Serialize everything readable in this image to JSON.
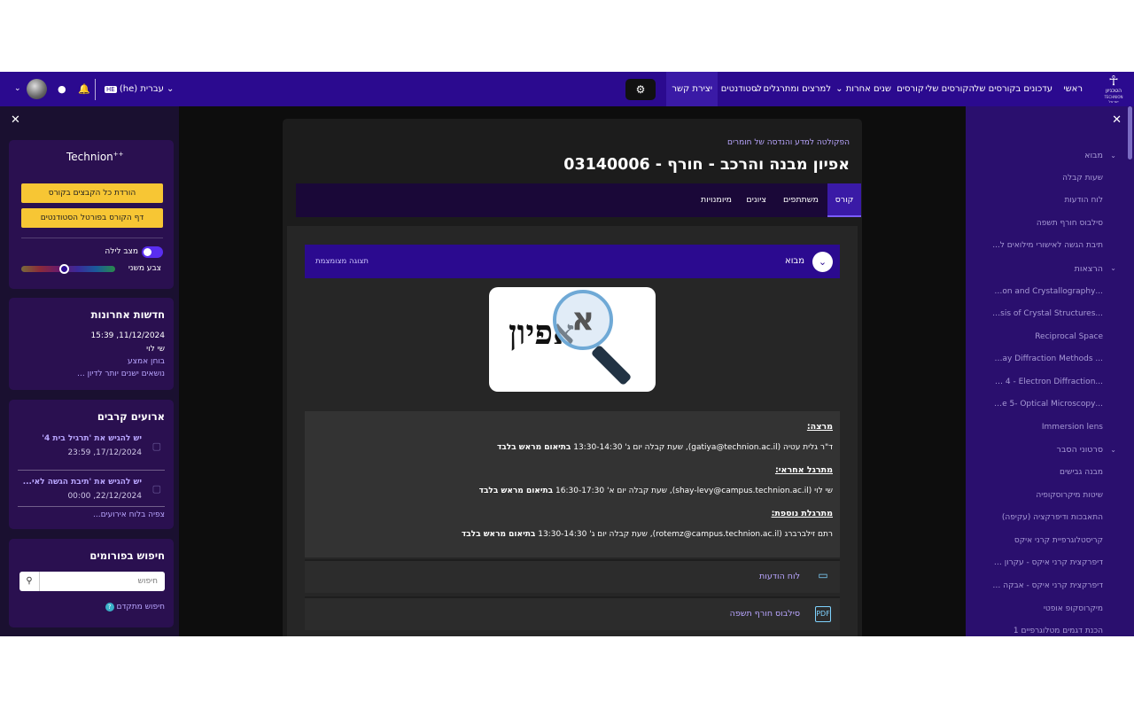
{
  "navbar": {
    "logo": {
      "line1": "הטכניון",
      "line2": "TECHNION",
      "line3": "ישראל"
    },
    "items": [
      "ראשי",
      "עדכונים בקורסים שלי",
      "הקורסים שלי",
      "קורסים",
      "שנים אחרות",
      "למרצים ומתרגלים",
      "לסטודנטים",
      "יצירת קשר"
    ],
    "language": "עברית (he)",
    "lang_code": "HE"
  },
  "left_drawer": {
    "brand": "Technion",
    "brand_sup": "++",
    "download_all": "הורדת כל הקבצים בקורס",
    "student_portal": "דף הקורס בפורטל הסטודנטים",
    "night_mode": "מצב לילה",
    "secondary_color": "צבע משני",
    "news": {
      "title": "חדשות אחרונות",
      "date": "11/12/2024, 15:39",
      "author": "שי לוי",
      "subject": "בוחן אמצע",
      "older": "נושאים ישנים יותר לדיון ..."
    },
    "events": {
      "title": "ארועים קרבים",
      "items": [
        {
          "title": "יש להגיש את 'תרגיל בית 4'",
          "date": "17/12/2024, 23:59"
        },
        {
          "title": "יש להגיש את 'תיבת הגשה לאי...",
          "date": "22/12/2024, 00:00"
        }
      ],
      "calendar_link": "צפיה בלוח אירועים..."
    },
    "forum_search": {
      "title": "חיפוש בפורומים",
      "placeholder": "חיפוש",
      "advanced": "חיפוש מתקדם"
    }
  },
  "course": {
    "breadcrumb": "הפקולטה למדע והנדסה של חומרים",
    "title": "אפיון מבנה והרכב - חורף - 03140006",
    "tabs": [
      "קורס",
      "משתתפים",
      "ציונים",
      "מיומנויות"
    ],
    "section": {
      "title": "מבוא",
      "collapsed_view": "תצוגה מצומצמת"
    },
    "image_text": "אפיון",
    "lecturer_label": "מרצה:",
    "lecturer_line_a": "ד\"ר גלית עטיה (gatiya@technion.ac.il), שעת קבלה יום ג' 13:30-14:30 ",
    "lecturer_line_b": "בתיאום מראש בלבד",
    "ta_label": "מתרגל אחראי:",
    "ta_line_a": "שי לוי (shay-levy@campus.technion.ac.il), שעת קבלה יום א' 16:30-17:30 ",
    "ta_line_b": "בתיאום מראש בלבד",
    "ta2_label": "מתרגלת נוספת:",
    "ta2_line_a": "רתם זילברברג (rotemz@campus.technion.ac.il), שעת קבלה יום ג' 13:30-14:30 ",
    "ta2_line_b": "בתיאום מראש בלבד",
    "activities": [
      "לוח הודעות",
      "סילבוס חורף תשפה"
    ]
  },
  "right_drawer": {
    "sections": [
      {
        "title": "מבוא",
        "items": [
          "שעות קבלה",
          "לוח הודעות",
          "סילבוס חורף תשפה",
          "תיבת הגשה לאישורי מילואים ל..."
        ]
      },
      {
        "title": "הרצאות",
        "items": [
          "...uction and Crystallography",
          "...alysis of Crystal Structures",
          "Reciprocal Space",
          "... X-ray Diffraction Methods",
          "...ture 4 - Electron Diffraction",
          "...ture 5- Optical Microscopy",
          "Immersion lens"
        ]
      },
      {
        "title": "סרטוני הסבר",
        "items": [
          "מבנה גבישים",
          "שיטות מיקרוסקופיה",
          "התאבכות ודיפרקציה (עקיפה)",
          "קריסטלוגרפיית קרני איקס",
          "דיפרקצית קרני איקס - עקרון פ...",
          "דיפרקצית קרני איקס - אבקה וג...",
          "מיקרוסקופ אופטי",
          "הכנת דגמים מטלוגרפיים 1"
        ]
      }
    ]
  },
  "colors": {
    "navbar": "#2b0a8f",
    "accent": "#f7c634",
    "link": "#b9a6ff"
  }
}
